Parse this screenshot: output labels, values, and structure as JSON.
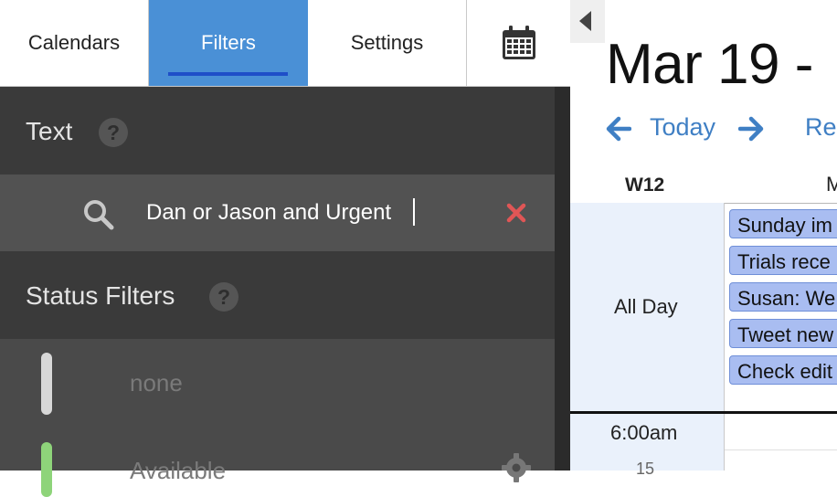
{
  "tabs": [
    {
      "label": "Calendars"
    },
    {
      "label": "Filters"
    },
    {
      "label": "Settings"
    }
  ],
  "calendar_tab_icon": "calendar-icon",
  "text_section": {
    "title": "Text",
    "help": "?"
  },
  "search": {
    "value": "Dan or Jason and Urgent"
  },
  "status_section": {
    "title": "Status Filters",
    "help": "?"
  },
  "status_filters": [
    {
      "label": "none",
      "color": "#d8d8d8"
    },
    {
      "label": "Available",
      "color": "#8ed47a"
    }
  ],
  "calendar": {
    "date_title": "Mar 19 -",
    "today_label": "Today",
    "next_label": "Re",
    "week_label": "W12",
    "day_label": "M",
    "allday_label": "All Day",
    "events": [
      "Sunday im",
      "Trials rece",
      "Susan: We",
      "Tweet new",
      "Check edit"
    ],
    "time_label": "6:00am",
    "time_sub": "15"
  },
  "colors": {
    "accent": "#4a90d6",
    "link": "#3f7fc4",
    "event_bg": "#a9bdf1",
    "clear": "#e05656"
  }
}
